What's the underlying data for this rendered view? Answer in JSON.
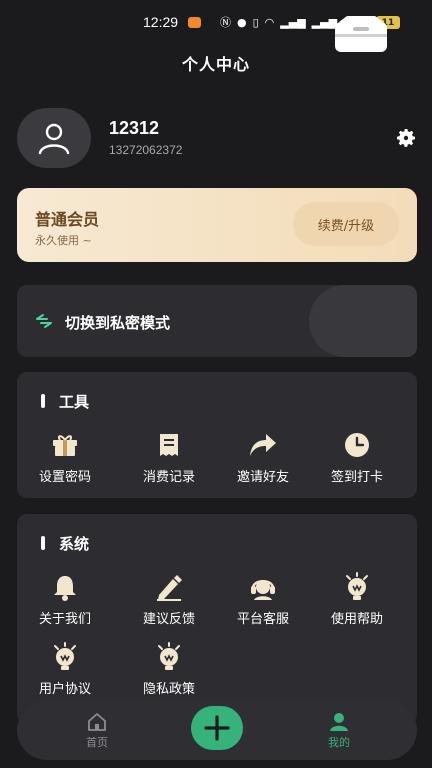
{
  "status_bar": {
    "time": "12:29",
    "battery": "11"
  },
  "header": {
    "title": "个人中心"
  },
  "profile": {
    "username": "12312",
    "phone": "13272062372"
  },
  "membership": {
    "title": "普通会员",
    "subtitle": "永久使用 ~",
    "renew_label": "续费/升级"
  },
  "private_mode": {
    "label": "切换到私密模式"
  },
  "tools": {
    "title": "工具",
    "items": [
      {
        "label": "设置密码",
        "icon": "gift-box-icon"
      },
      {
        "label": "消费记录",
        "icon": "receipt-icon"
      },
      {
        "label": "邀请好友",
        "icon": "share-arrow-icon"
      },
      {
        "label": "签到打卡",
        "icon": "clock-icon"
      }
    ]
  },
  "system": {
    "title": "系统",
    "items": [
      {
        "label": "关于我们",
        "icon": "bell-icon"
      },
      {
        "label": "建议反馈",
        "icon": "pencil-icon"
      },
      {
        "label": "平台客服",
        "icon": "headset-icon"
      },
      {
        "label": "使用帮助",
        "icon": "lightbulb-icon"
      },
      {
        "label": "用户协议",
        "icon": "lightbulb-icon"
      },
      {
        "label": "隐私政策",
        "icon": "lightbulb-icon"
      }
    ]
  },
  "bottom_nav": {
    "home_label": "首页",
    "mine_label": "我的"
  },
  "colors": {
    "accent": "#35b37a",
    "background": "#1b1b1e",
    "card": "#2d2d31",
    "member_gold": "#f3dcb8"
  }
}
